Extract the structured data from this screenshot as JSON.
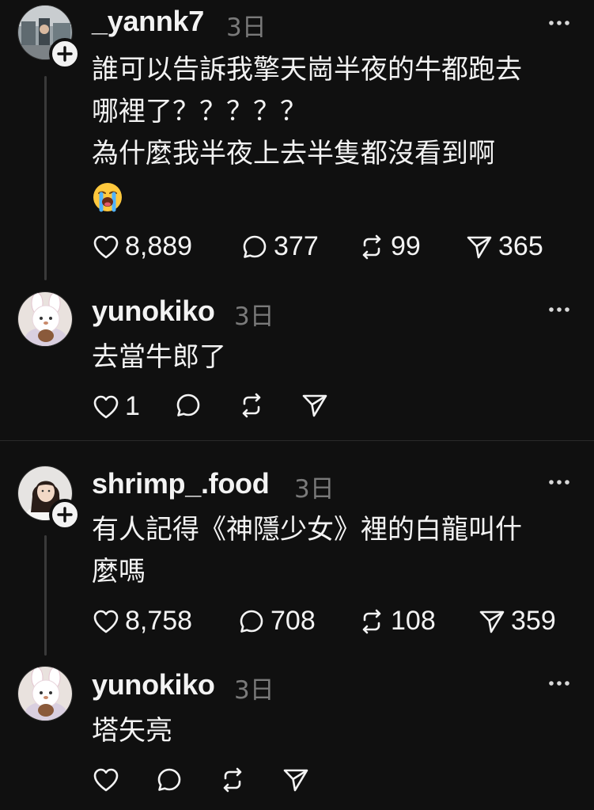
{
  "threads": [
    {
      "post": {
        "username": "_yannk7",
        "time": "3日",
        "lines": [
          "誰可以告訴我擎天崗半夜的牛都跑去",
          "哪裡了？？？？？",
          "為什麼我半夜上去半隻都沒看到啊"
        ],
        "emoji": "loudly-crying-face",
        "likes": "8,889",
        "comments": "377",
        "reposts": "99",
        "shares": "365"
      },
      "reply": {
        "username": "yunokiko",
        "time": "3日",
        "text": "去當牛郎了",
        "likes": "1"
      }
    },
    {
      "post": {
        "username": "shrimp_.food",
        "time": "3日",
        "lines": [
          "有人記得《神隱少女》裡的白龍叫什",
          "麼嗎"
        ],
        "likes": "8,758",
        "comments": "708",
        "reposts": "108",
        "shares": "359"
      },
      "reply": {
        "username": "yunokiko",
        "time": "3日",
        "text": "塔矢亮"
      }
    }
  ],
  "icons": {
    "like": "heart-icon",
    "comment": "comment-bubble-icon",
    "repost": "repost-icon",
    "share": "send-icon",
    "more": "more-options-icon",
    "follow": "plus-icon"
  },
  "colors": {
    "background": "#101010",
    "text": "#f3f3f3",
    "muted": "#7a7a7a",
    "divider": "#2a2a2a"
  }
}
